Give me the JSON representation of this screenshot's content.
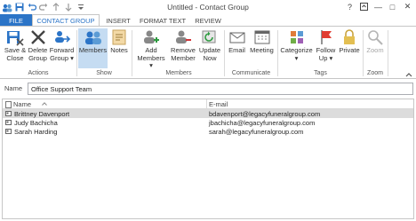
{
  "window": {
    "title": "Untitled - Contact Group",
    "buttons": {
      "help": "?",
      "restore": "□",
      "minimize": "—",
      "maximize": "□",
      "close": "✕"
    }
  },
  "tabs": [
    "FILE",
    "CONTACT GROUP",
    "INSERT",
    "FORMAT TEXT",
    "REVIEW"
  ],
  "ribbon": {
    "actions": {
      "save_close": [
        "Save &",
        "Close"
      ],
      "delete_group": [
        "Delete",
        "Group"
      ],
      "forward_group": [
        "Forward",
        "Group ▾"
      ],
      "label": "Actions"
    },
    "show": {
      "members": "Members",
      "notes": "Notes",
      "label": "Show"
    },
    "members": {
      "add_members": [
        "Add",
        "Members ▾"
      ],
      "remove_member": [
        "Remove",
        "Member"
      ],
      "update_now": [
        "Update",
        "Now"
      ],
      "label": "Members"
    },
    "communicate": {
      "email": "Email",
      "meeting": "Meeting",
      "label": "Communicate"
    },
    "tags": {
      "categorize": [
        "Categorize",
        "▾"
      ],
      "follow_up": [
        "Follow",
        "Up ▾"
      ],
      "private": "Private",
      "label": "Tags"
    },
    "zoom": {
      "zoom": "Zoom",
      "label": "Zoom"
    },
    "colors": {
      "accent": "#2b74c7",
      "selected": "#c5dcf2"
    }
  },
  "name_field": {
    "label": "Name",
    "value": "Office Support Team"
  },
  "table": {
    "headers": {
      "name": "Name",
      "email": "E-mail"
    },
    "rows": [
      {
        "name": "Brittney Davenport",
        "email": "bdavenport@legacyfuneralgroup.com",
        "selected": true
      },
      {
        "name": "Judy Bachicha",
        "email": "jbachicha@legacyfuneralgroup.com",
        "selected": false
      },
      {
        "name": "Sarah Harding",
        "email": "sarah@legacyfuneralgroup.com",
        "selected": false
      }
    ]
  }
}
